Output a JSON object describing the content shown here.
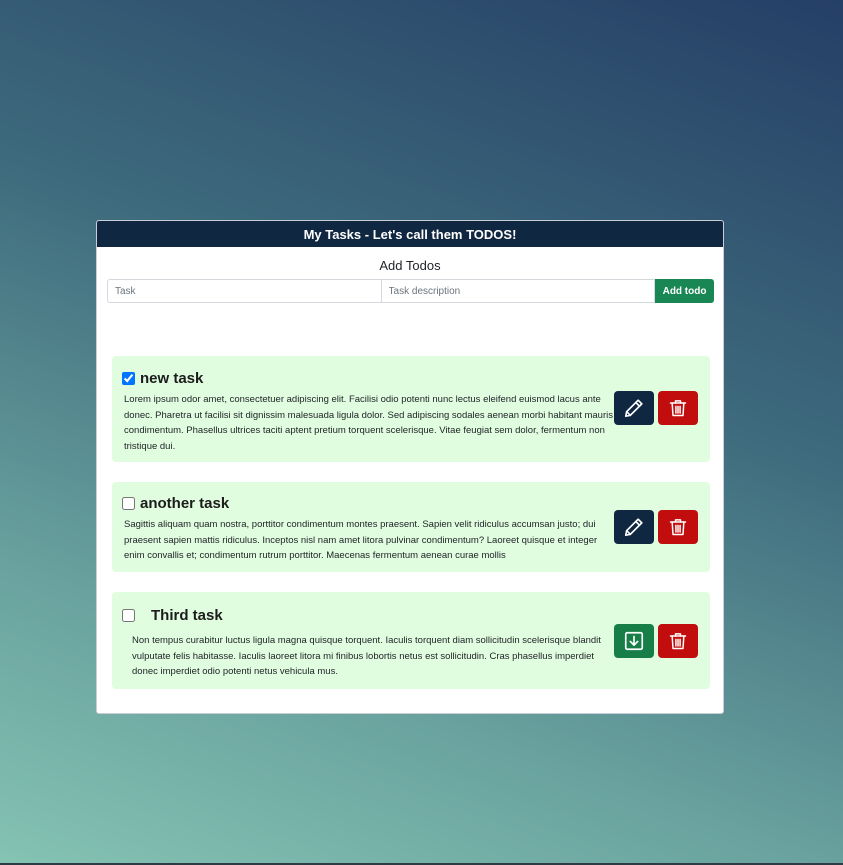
{
  "header": {
    "title": "My Tasks - Let's call them TODOS!"
  },
  "add_form": {
    "title": "Add Todos",
    "task_placeholder": "Task",
    "desc_placeholder": "Task description",
    "task_value": "",
    "desc_value": "",
    "button_label": "Add todo"
  },
  "todos": [
    {
      "title": "new task",
      "checked": true,
      "description": "Lorem ipsum odor amet, consectetuer adipiscing elit. Facilisi odio potenti nunc lectus eleifend euismod lacus ante donec. Pharetra ut facilisi sit dignissim malesuada ligula dolor. Sed adipiscing sodales aenean morbi habitant mauris condimentum. Phasellus ultrices taciti aptent pretium torquent scelerisque. Vitae feugiat sem dolor, fermentum non tristique dui.",
      "actions": [
        "pencil-icon",
        "trash-icon"
      ]
    },
    {
      "title": "another task",
      "checked": false,
      "description": "Sagittis aliquam quam nostra, porttitor condimentum montes praesent. Sapien velit ridiculus accumsan justo; dui praesent sapien mattis ridiculus. Inceptos nisl nam amet litora pulvinar condimentum? Laoreet quisque et integer enim convallis et; condimentum rutrum porttitor. Maecenas fermentum aenean curae mollis",
      "actions": [
        "pencil-icon",
        "trash-icon"
      ]
    },
    {
      "title": "Third task",
      "checked": false,
      "description": "Non tempus curabitur luctus ligula magna quisque torquent. Iaculis torquent diam sollicitudin scelerisque blandit vulputate felis habitasse. Iaculis laoreet litora mi finibus lobortis netus est sollicitudin. Cras phasellus imperdiet donec imperdiet odio potenti netus vehicula mus.",
      "actions": [
        "save-icon",
        "trash-icon"
      ]
    }
  ],
  "colors": {
    "header_bg": "#0f2741",
    "todo_bg": "#e1fde0",
    "add_button": "#198754",
    "edit_button": "#0f2741",
    "delete_button": "#c10d0d",
    "save_button": "#177e48"
  }
}
